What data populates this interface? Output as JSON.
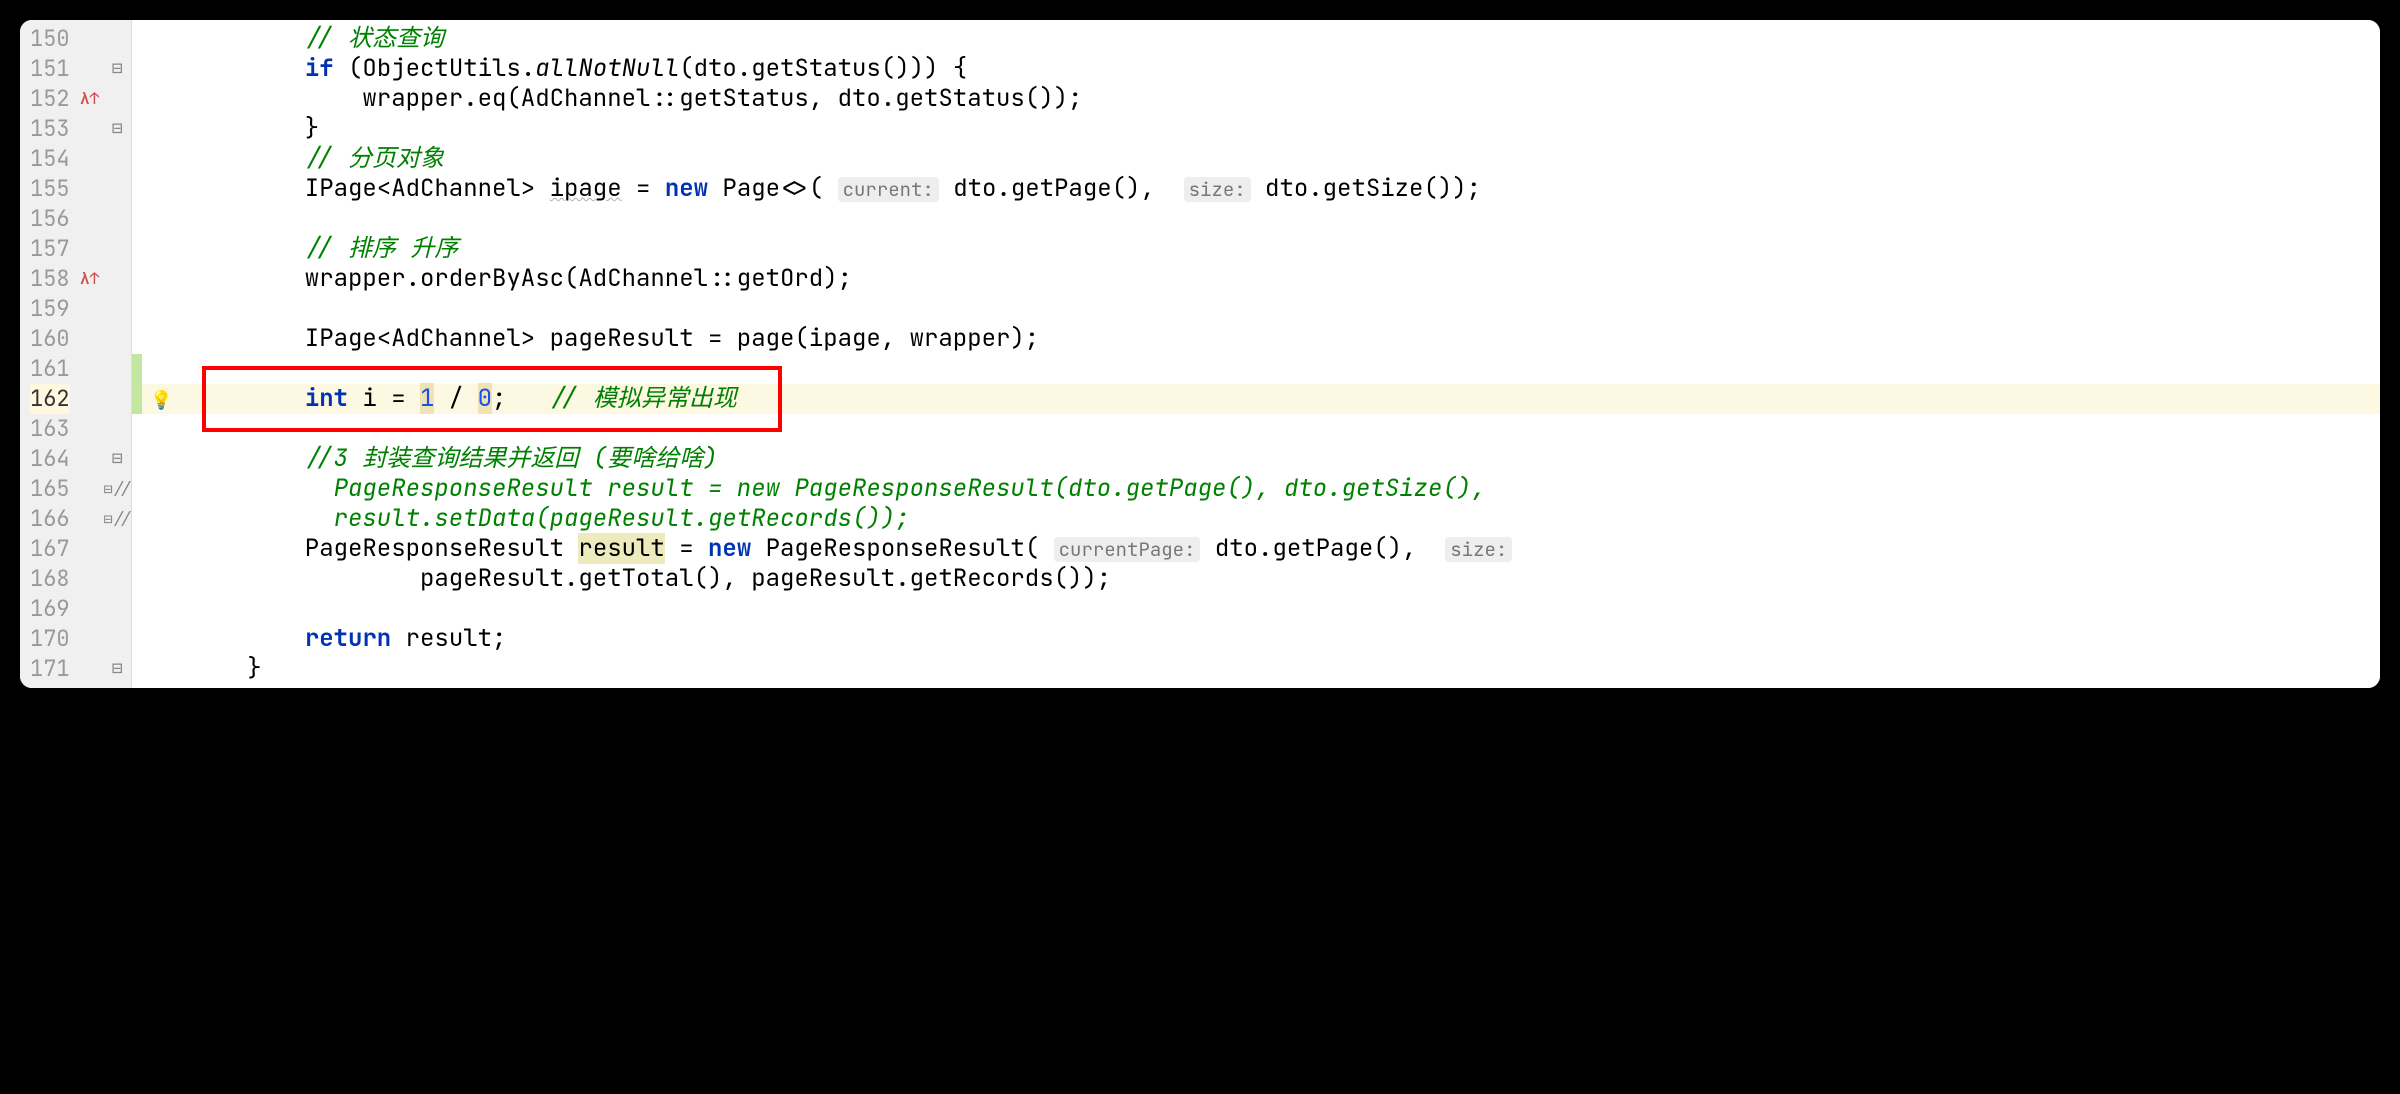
{
  "gutter": {
    "lineStart": 150,
    "lineEnd": 171,
    "currentLine": 162,
    "lambdaMarkers": [
      152,
      158
    ],
    "foldMarkers": {
      "151": "down",
      "153": "up",
      "164": "down",
      "165": "split",
      "166": "split",
      "171": "up"
    },
    "commentMarkers": {
      "165": "//",
      "166": "//"
    },
    "changedLines": [
      161,
      162
    ],
    "bulbLine": 162
  },
  "redBox": {
    "startLine": 161,
    "endLine": 162
  },
  "code": {
    "150": {
      "indent": "        ",
      "tokens": [
        {
          "t": "comment",
          "v": "// 状态查询"
        }
      ]
    },
    "151": {
      "indent": "        ",
      "tokens": [
        {
          "t": "kw",
          "v": "if"
        },
        {
          "t": "plain",
          "v": " (ObjectUtils."
        },
        {
          "t": "static",
          "v": "allNotNull"
        },
        {
          "t": "plain",
          "v": "(dto.getStatus())) {"
        }
      ]
    },
    "152": {
      "indent": "            ",
      "tokens": [
        {
          "t": "plain",
          "v": "wrapper.eq(AdChannel::getStatus, dto.getStatus());"
        }
      ]
    },
    "153": {
      "indent": "        ",
      "tokens": [
        {
          "t": "plain",
          "v": "}"
        }
      ]
    },
    "154": {
      "indent": "        ",
      "tokens": [
        {
          "t": "comment",
          "v": "// 分页对象"
        }
      ]
    },
    "155": {
      "indent": "        ",
      "tokens": [
        {
          "t": "plain",
          "v": "IPage<AdChannel> "
        },
        {
          "t": "warn",
          "v": "ipage"
        },
        {
          "t": "plain",
          "v": " = "
        },
        {
          "t": "kw",
          "v": "new"
        },
        {
          "t": "plain",
          "v": " Page<>( "
        },
        {
          "t": "hint",
          "v": "current:"
        },
        {
          "t": "plain",
          "v": " dto.getPage(),  "
        },
        {
          "t": "hint",
          "v": "size:"
        },
        {
          "t": "plain",
          "v": " dto.getSize());"
        }
      ]
    },
    "156": {
      "indent": "",
      "tokens": []
    },
    "157": {
      "indent": "        ",
      "tokens": [
        {
          "t": "comment",
          "v": "// 排序 升序"
        }
      ]
    },
    "158": {
      "indent": "        ",
      "tokens": [
        {
          "t": "plain",
          "v": "wrapper.orderByAsc(AdChannel::getOrd);"
        }
      ]
    },
    "159": {
      "indent": "",
      "tokens": []
    },
    "160": {
      "indent": "        ",
      "tokens": [
        {
          "t": "plain",
          "v": "IPage<AdChannel> pageResult = page(ipage, wrapper);"
        }
      ]
    },
    "161": {
      "indent": "",
      "tokens": []
    },
    "162": {
      "indent": "        ",
      "tokens": [
        {
          "t": "kw",
          "v": "int"
        },
        {
          "t": "plain",
          "v": " i = "
        },
        {
          "t": "hlnum",
          "v": "1"
        },
        {
          "t": "plain",
          "v": " / "
        },
        {
          "t": "hlnum",
          "v": "0"
        },
        {
          "t": "plain",
          "v": ";   "
        },
        {
          "t": "comment",
          "v": "// 模拟异常出现"
        }
      ]
    },
    "163": {
      "indent": "",
      "tokens": []
    },
    "164": {
      "indent": "        ",
      "tokens": [
        {
          "t": "comment",
          "v": "//3 封装查询结果并返回 (要啥给啥)"
        }
      ]
    },
    "165": {
      "indent": "          ",
      "tokens": [
        {
          "t": "commentblk",
          "v": "PageResponseResult result = new PageResponseResult(dto.getPage(), dto.getSize(),"
        }
      ]
    },
    "166": {
      "indent": "          ",
      "tokens": [
        {
          "t": "commentblk",
          "v": "result.setData(pageResult.getRecords());"
        }
      ]
    },
    "167": {
      "indent": "        ",
      "tokens": [
        {
          "t": "plain",
          "v": "PageResponseResult "
        },
        {
          "t": "hlvar",
          "v": "result"
        },
        {
          "t": "plain",
          "v": " = "
        },
        {
          "t": "kw",
          "v": "new"
        },
        {
          "t": "plain",
          "v": " PageResponseResult( "
        },
        {
          "t": "hint",
          "v": "currentPage:"
        },
        {
          "t": "plain",
          "v": " dto.getPage(),  "
        },
        {
          "t": "hint",
          "v": "size:"
        }
      ]
    },
    "168": {
      "indent": "                ",
      "tokens": [
        {
          "t": "plain",
          "v": "pageResult.getTotal(), pageResult.getRecords());"
        }
      ]
    },
    "169": {
      "indent": "",
      "tokens": []
    },
    "170": {
      "indent": "        ",
      "tokens": [
        {
          "t": "kw",
          "v": "return"
        },
        {
          "t": "plain",
          "v": " result;"
        }
      ]
    },
    "171": {
      "indent": "    ",
      "tokens": [
        {
          "t": "plain",
          "v": "}"
        }
      ]
    }
  }
}
